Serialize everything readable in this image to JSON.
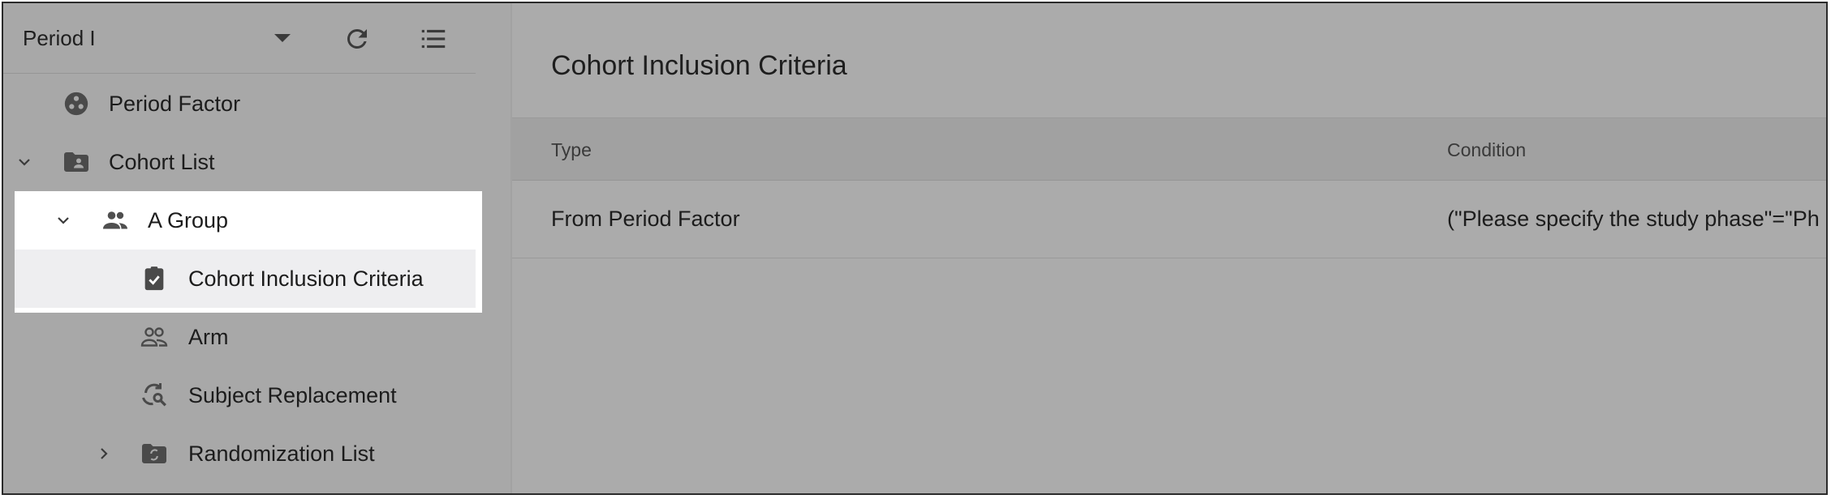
{
  "sidebar": {
    "period_select": {
      "value": "Period I"
    },
    "tree": [
      {
        "label": "Period Factor",
        "icon": "period-factor-icon"
      },
      {
        "label": "Cohort List",
        "icon": "folder-account-icon"
      },
      {
        "label": "A Group",
        "icon": "group-icon"
      },
      {
        "label": "Cohort Inclusion Criteria",
        "icon": "clipboard-check-icon"
      },
      {
        "label": "Arm",
        "icon": "people-outline-icon"
      },
      {
        "label": "Subject Replacement",
        "icon": "replace-search-icon"
      },
      {
        "label": "Randomization List",
        "icon": "folder-sync-icon"
      }
    ]
  },
  "content": {
    "title": "Cohort Inclusion Criteria",
    "columns": [
      "Type",
      "Condition"
    ],
    "rows": [
      {
        "type": "From Period Factor",
        "condition": "(\"Please specify the study phase\"=\"Ph"
      }
    ]
  },
  "colors": {
    "overlay_gray": "#ababab",
    "highlight": "#ffffff",
    "selected_row": "#eeeef0"
  }
}
